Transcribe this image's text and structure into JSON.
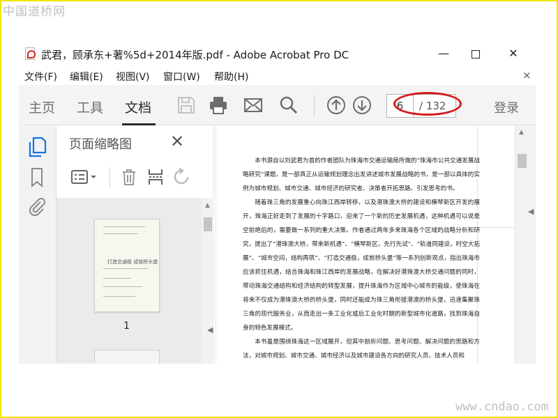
{
  "watermarks": {
    "top_left": "中国道桥网",
    "bottom_right": "www.cndao.com"
  },
  "window": {
    "title": "武君，顾承东+著%5d+2014年版.pdf - Adobe Acrobat Pro DC",
    "minimize": "—",
    "close": "✕"
  },
  "menu": {
    "items": [
      "文件(F)",
      "编辑(E)",
      "视图(V)",
      "窗口(W)",
      "帮助(H)"
    ],
    "close": "×"
  },
  "toolbar": {
    "tabs": [
      "主页",
      "工具",
      "文档"
    ],
    "active_tab": "文档",
    "icons": [
      "save-icon",
      "print-icon",
      "email-icon",
      "search-icon",
      "page-up-icon",
      "page-down-icon"
    ],
    "page_current": "6",
    "page_total": "/ 132",
    "login": "登录",
    "highlight_color": "#d61a1a"
  },
  "left_rail": {
    "icons": [
      "page-thumbnails-icon",
      "bookmark-icon",
      "attachment-icon"
    ]
  },
  "thumbnail_panel": {
    "title": "页面缩略图",
    "close": "✕",
    "thumbnail_title": "打造交通极 成就桥头堡",
    "page_label": "1"
  },
  "document": {
    "paragraphs": [
      "本书源自以刘武君为首的作者团队为珠海市交通运输局所做的“珠海市公共交通发展战略研究”课题，是一部真正从运输规划理念出发讲述城市发展战略的书，是一部以具体的实例为城市规划、城市交通、城市经济的研究者、决策者开拓思路、引发思考的书。",
      "随着珠三角的发展重心向珠江西岸转移，以及港珠澳大桥的建设和横琴新区开发的展开，珠海正好走到了发展的十字路口，迎来了一个新的历史发展机遇，这种机遇可以说是空前绝后的，需要做一系列的重大决策。作者通过两年多来珠海各个区域的战略分析和研究，提出了“港珠澳大桥，带来新机遇”、“横琴新区，先行先试”、“轨道同建设，时空大拓展”、“城市空间，结构再筑”、“打造交通极，成就桥头堡”等一系列创新观点，指出珠海市应该抓住机遇，结合珠海和珠江西岸的发展战略，在解决好港珠澳大桥交通问题的同时，带动珠海交通结构和经济结构的转型发展，提升珠海作为区域中心城市的能级，使珠海在将来不仅成为港珠澳大桥的桥头堡，同时还能成为珠三角衔接港澳的桥头堡，迅速集聚珠三角的现代服务业，从而走出一条工业化或后工业化时期的新型城市化道路，找到珠海自身的特色发展模式。",
      "本书虽是围绕珠海这一区域展开，但其中剖析问题、思考问题、解决问题的思路和方法，对城市规划、城市交通、城市经济以及城市建设各方向的研究人员、技术人员和"
    ]
  }
}
